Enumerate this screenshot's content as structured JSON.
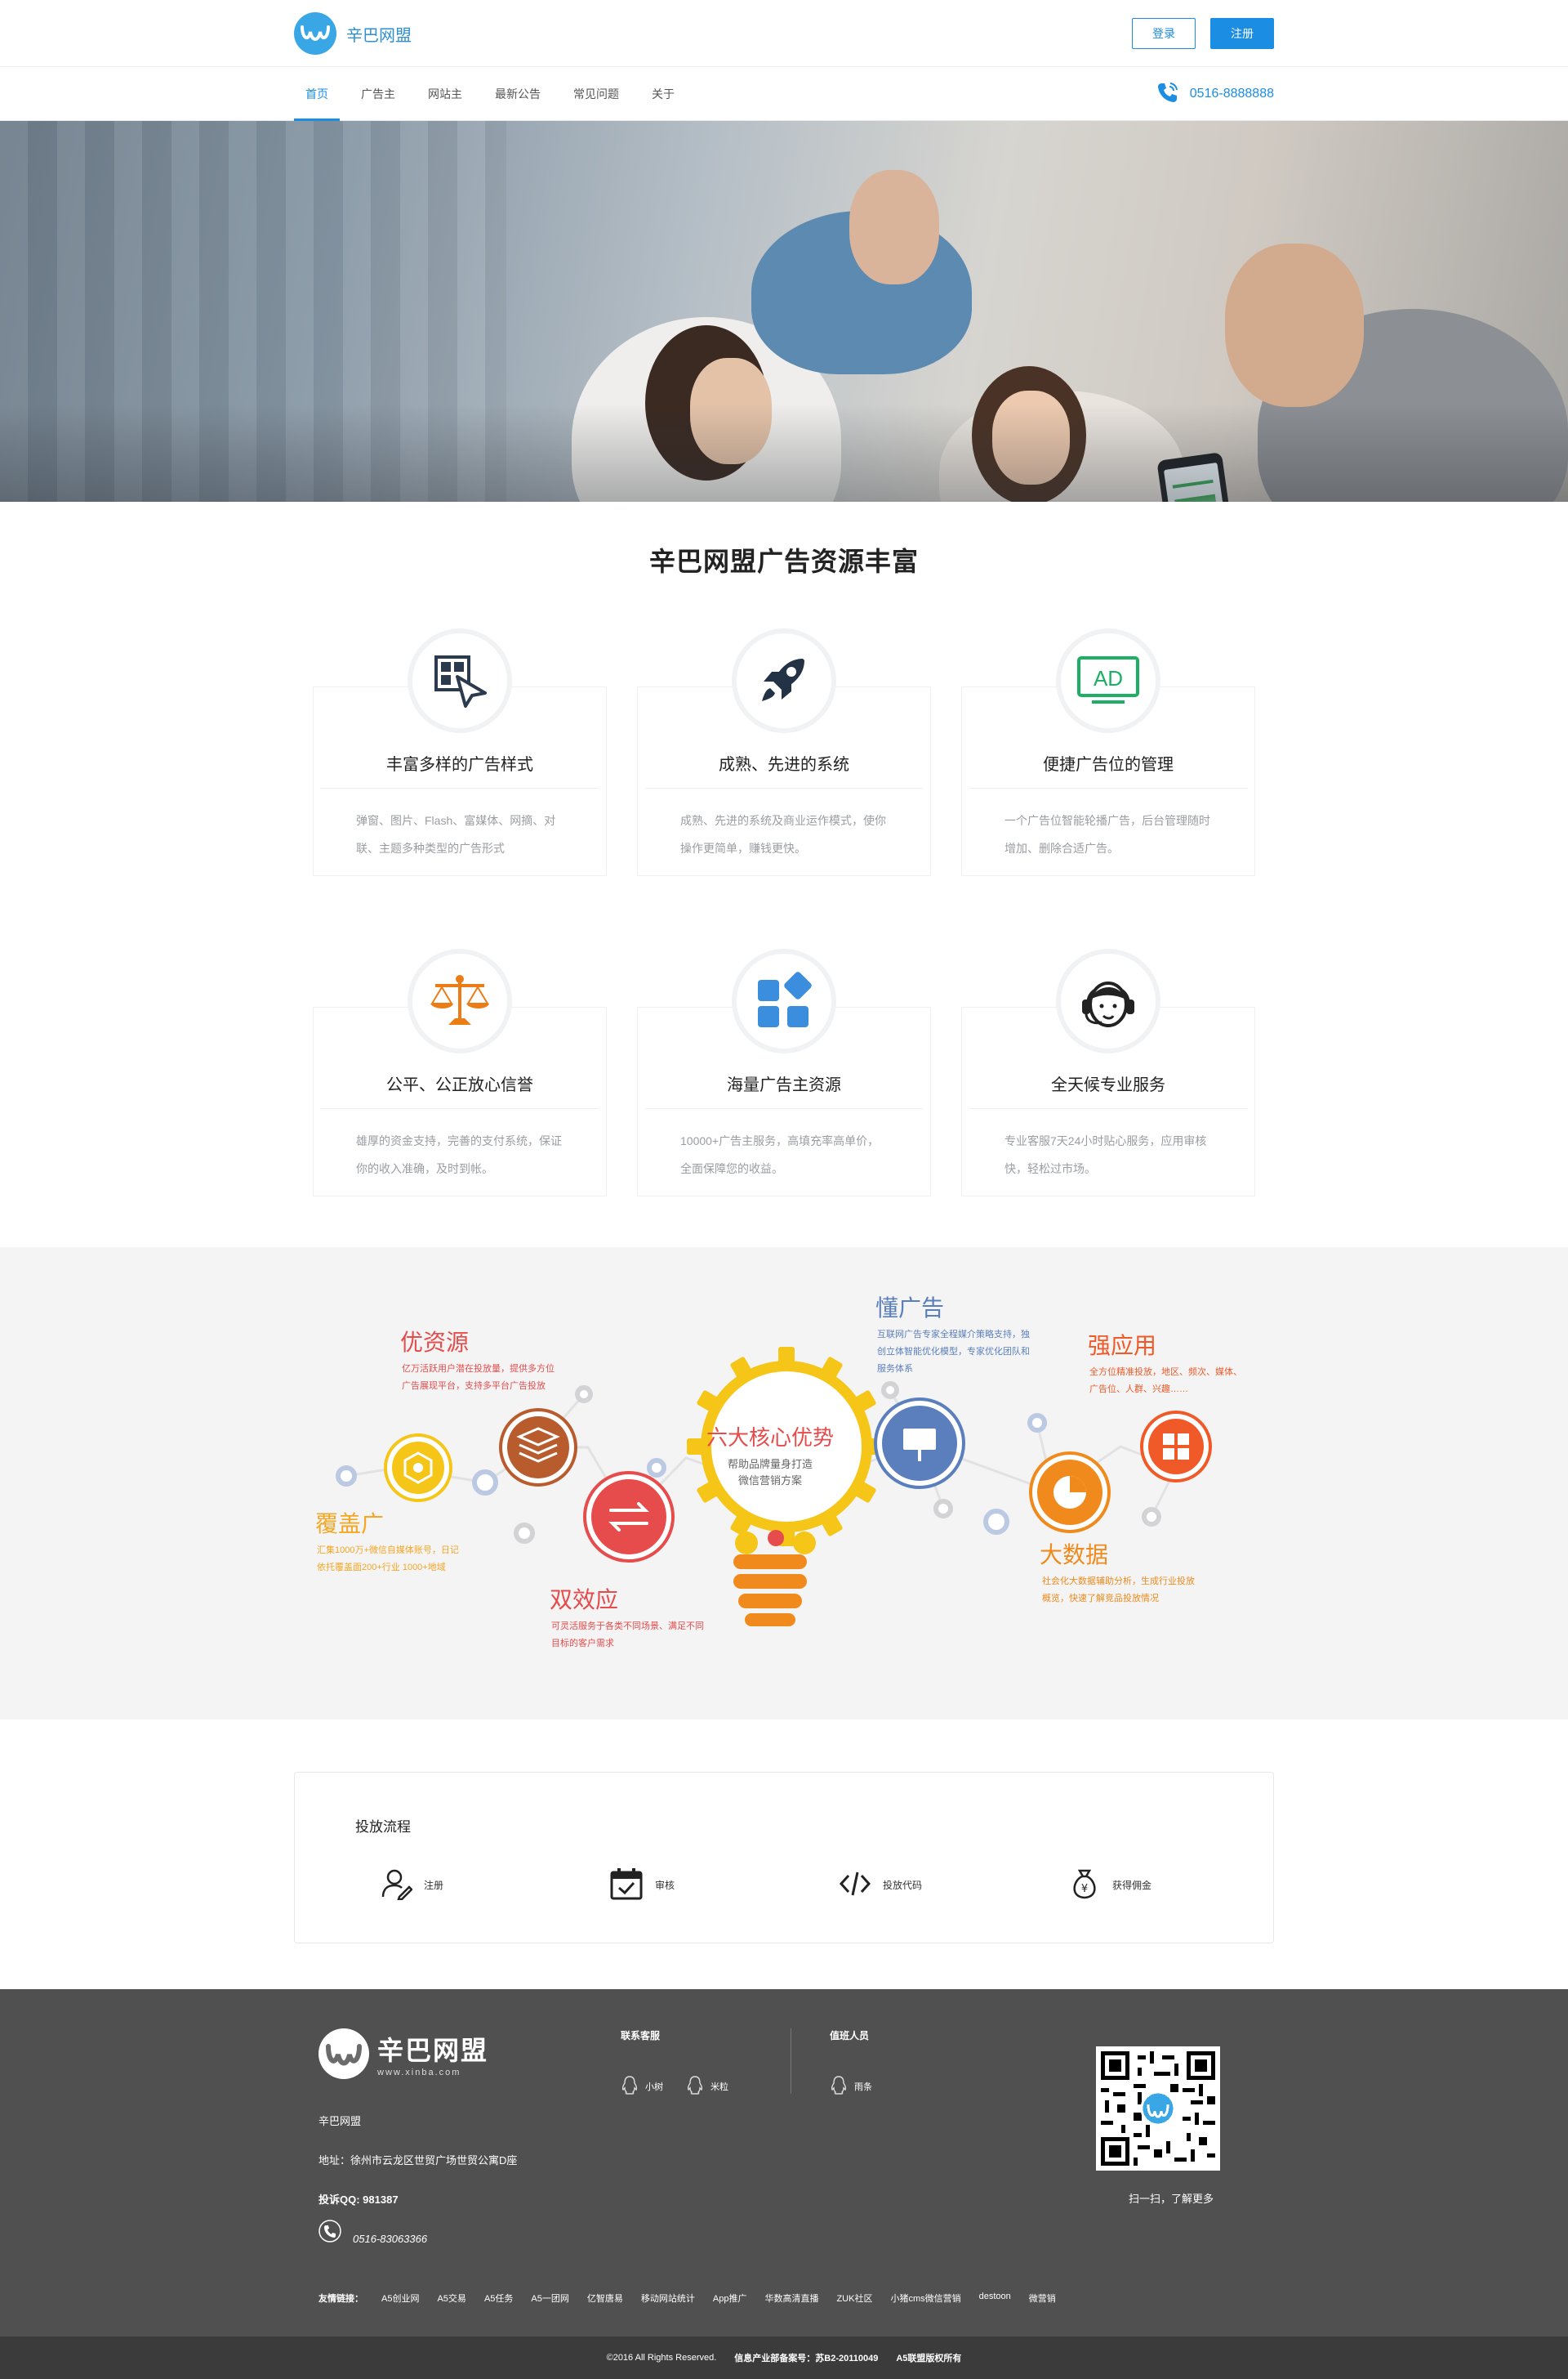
{
  "header": {
    "brand": "辛巴网盟",
    "login_label": "登录",
    "register_label": "注册"
  },
  "nav": {
    "items": [
      {
        "label": "首页",
        "active": true
      },
      {
        "label": "广告主"
      },
      {
        "label": "网站主"
      },
      {
        "label": "最新公告"
      },
      {
        "label": "常见问题"
      },
      {
        "label": "关于"
      }
    ],
    "phone": "0516-8888888"
  },
  "features": {
    "title": "辛巴网盟广告资源丰富",
    "cards": [
      {
        "icon": "ad-style-icon",
        "title": "丰富多样的广告样式",
        "desc": "弹窗、图片、Flash、富媒体、网摘、对联、主题多种类型的广告形式"
      },
      {
        "icon": "rocket-icon",
        "title": "成熟、先进的系统",
        "desc": "成熟、先进的系统及商业运作模式，使你操作更简单，赚钱更快。"
      },
      {
        "icon": "ad-board-icon",
        "title": "便捷广告位的管理",
        "desc": "一个广告位智能轮播广告，后台管理随时增加、删除合适广告。"
      },
      {
        "icon": "scales-icon",
        "title": "公平、公正放心信誉",
        "desc": "雄厚的资金支持，完善的支付系统，保证你的收入准确，及时到帐。"
      },
      {
        "icon": "apps-grid-icon",
        "title": "海量广告主资源",
        "desc": "10000+广告主服务，高填充率高单价，全面保障您的收益。"
      },
      {
        "icon": "support-agent-icon",
        "title": "全天候专业服务",
        "desc": "专业客服7天24小时贴心服务，应用审核快，轻松过市场。"
      }
    ]
  },
  "advantages": {
    "center_title": "六大核心优势",
    "center_sub1": "帮助品牌量身打造",
    "center_sub2": "微信营销方案",
    "items": [
      {
        "title": "优资源",
        "line1": "亿万活跃用户潜在投放量，提供多方位",
        "line2": "广告展现平台，支持多平台广告投放"
      },
      {
        "title": "覆盖广",
        "line1": "汇集1000万+微信自媒体账号，日记",
        "line2": "依托覆盖面200+行业 1000+地域"
      },
      {
        "title": "双效应",
        "line1": "可灵活服务于各类不同场景、满足不同",
        "line2": "目标的客户需求"
      },
      {
        "title": "懂广告",
        "line1": "互联网广告专家全程媒介策略支持，独",
        "line2": "创立体智能优化模型，专家优化团队和",
        "line3": "服务体系"
      },
      {
        "title": "强应用",
        "line1": "全方位精准投放，地区、频次、媒体、",
        "line2": "广告位、人群、兴趣……"
      },
      {
        "title": "大数据",
        "line1": "社会化大数据辅助分析，生成行业投放",
        "line2": "概览，快速了解竞品投放情况"
      }
    ],
    "colors": {
      "gold": "#f5c518",
      "red": "#e64c4c",
      "blue": "#5b7fbd",
      "orange": "#f08a1c",
      "brown": "#b85c2e"
    }
  },
  "process": {
    "title": "投放流程",
    "steps": [
      {
        "icon": "user-register-icon",
        "label": "注册"
      },
      {
        "icon": "calendar-check-icon",
        "label": "审核"
      },
      {
        "icon": "code-icon",
        "label": "投放代码"
      },
      {
        "icon": "money-bag-icon",
        "label": "获得佣金"
      }
    ]
  },
  "footer": {
    "brand_name": "辛巴网盟",
    "brand_url": "www.xinba.com",
    "company": "辛巴网盟",
    "address": "地址：徐州市云龙区世贸广场世贸公寓D座",
    "complaint_qq": "投诉QQ: 981387",
    "tel": "0516-83063366",
    "service_title": "联系客服",
    "service_agents": [
      "小树",
      "米粒"
    ],
    "duty_title": "值班人员",
    "duty_agents": [
      "雨条"
    ],
    "qr_caption": "扫一扫，了解更多",
    "links_label": "友情链接：",
    "links": [
      "A5创业网",
      "A5交易",
      "A5任务",
      "A5一团网",
      "亿智唐易",
      "移动网站统计",
      "App推广",
      "华数高清直播",
      "ZUK社区",
      "小猪cms微信营销",
      "destoon",
      "微营销"
    ],
    "copyright": "©2016 All Rights Reserved.",
    "icp": "信息产业部备案号：苏B2-20110049",
    "rights": "A5联盟版权所有"
  }
}
